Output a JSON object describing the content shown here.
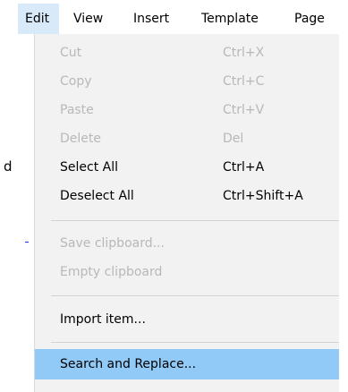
{
  "menubar": {
    "items": [
      {
        "label": "Edit",
        "active": true
      },
      {
        "label": "View"
      },
      {
        "label": "Insert"
      },
      {
        "label": "Template"
      },
      {
        "label": "Page"
      }
    ]
  },
  "background": {
    "fragment_text": "d"
  },
  "edit_menu": {
    "items": [
      {
        "label": "Cut",
        "shortcut": "Ctrl+X",
        "enabled": false
      },
      {
        "label": "Copy",
        "shortcut": "Ctrl+C",
        "enabled": false
      },
      {
        "label": "Paste",
        "shortcut": "Ctrl+V",
        "enabled": false
      },
      {
        "label": "Delete",
        "shortcut": "Del",
        "enabled": false
      },
      {
        "label": "Select All",
        "shortcut": "Ctrl+A",
        "enabled": true
      },
      {
        "label": "Deselect All",
        "shortcut": "Ctrl+Shift+A",
        "enabled": true
      },
      {
        "label": "Save clipboard...",
        "shortcut": "",
        "enabled": false
      },
      {
        "label": "Empty clipboard",
        "shortcut": "",
        "enabled": false
      },
      {
        "label": "Import item...",
        "shortcut": "",
        "enabled": true
      },
      {
        "label": "Search and Replace...",
        "shortcut": "",
        "enabled": true,
        "highlighted": true
      }
    ]
  },
  "colors": {
    "menu_bg": "#f2f2f2",
    "highlight": "#91c9f7",
    "active_menubar": "#d8eaf9",
    "disabled_text": "#b8b8b8"
  }
}
